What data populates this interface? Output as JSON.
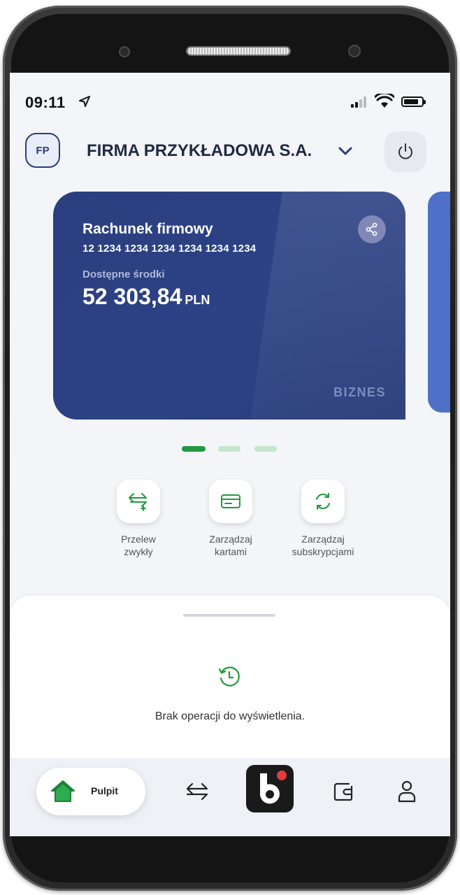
{
  "status_bar": {
    "time": "09:11"
  },
  "header": {
    "avatar_initials": "FP",
    "company_name": "FIRMA PRZYKŁADOWA S.A."
  },
  "account_card": {
    "name": "Rachunek firmowy",
    "number": "12 1234 1234 1234 1234 1234 1234",
    "available_label": "Dostępne środki",
    "balance": "52 303,84",
    "currency": "PLN",
    "tag": "BIZNES"
  },
  "carousel": {
    "pages": 3,
    "active_index": 0
  },
  "quick_actions": [
    {
      "line1": "Przelew",
      "line2": "zwykły",
      "icon": "transfer-plus-icon"
    },
    {
      "line1": "Zarządzaj",
      "line2": "kartami",
      "icon": "card-icon"
    },
    {
      "line1": "Zarządzaj",
      "line2": "subskrypcjami",
      "icon": "refresh-icon"
    }
  ],
  "operations": {
    "empty_message": "Brak operacji do wyświetlenia."
  },
  "bottom_nav": {
    "home_label": "Pulpit",
    "items": [
      "home-icon",
      "transfers-icon",
      "blik-icon",
      "wallet-icon",
      "profile-icon"
    ]
  },
  "colors": {
    "card_bg": "#2d4285",
    "accent_green": "#1f9a3e",
    "screen_bg": "#f3f5f8"
  }
}
